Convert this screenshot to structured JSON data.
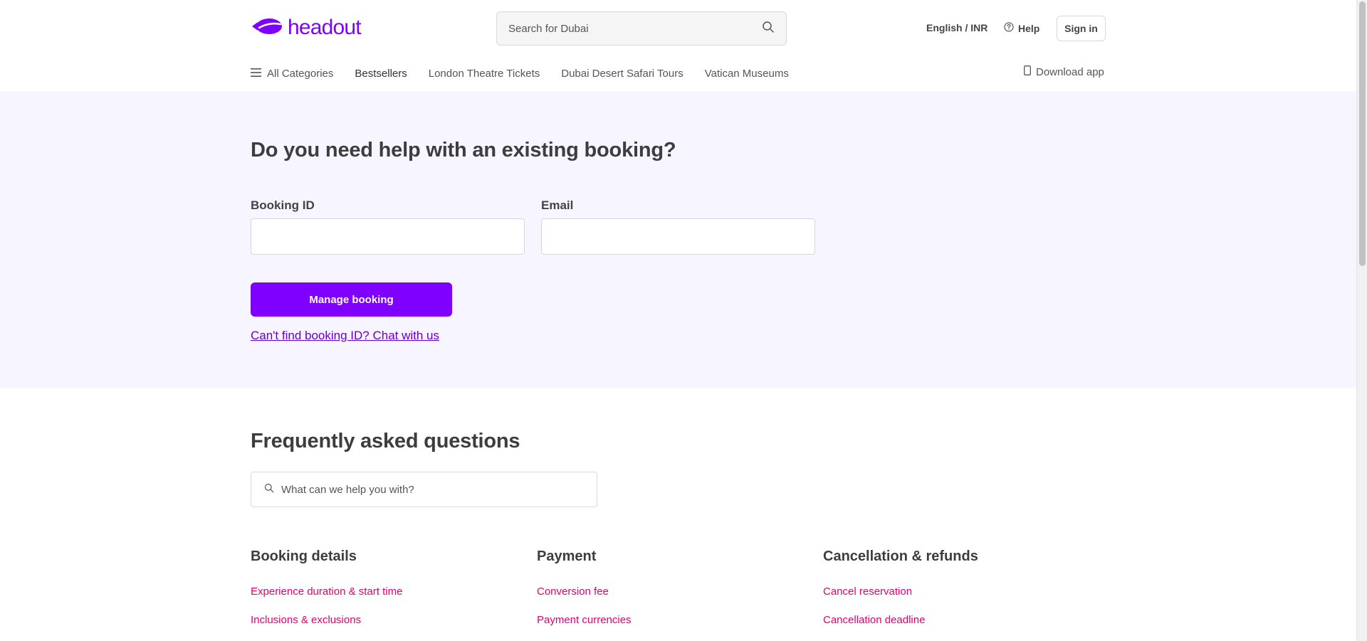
{
  "header": {
    "logo_text": "headout",
    "search_placeholder": "Search for Dubai",
    "language_currency": "English / INR",
    "help_label": "Help",
    "signin_label": "Sign in"
  },
  "nav": {
    "all_categories": "All Categories",
    "items": [
      "Bestsellers",
      "London Theatre Tickets",
      "Dubai Desert Safari Tours",
      "Vatican Museums"
    ],
    "download_app": "Download app"
  },
  "help_section": {
    "title": "Do you need help with an existing booking?",
    "booking_id_label": "Booking ID",
    "booking_id_value": "",
    "email_label": "Email",
    "email_value": "",
    "manage_button": "Manage booking",
    "chat_link": "Can't find booking ID? Chat with us"
  },
  "faq": {
    "title": "Frequently asked questions",
    "search_placeholder": "What can we help you with?",
    "columns": [
      {
        "title": "Booking details",
        "links": [
          "Experience duration & start time",
          "Inclusions & exclusions"
        ]
      },
      {
        "title": "Payment",
        "links": [
          "Conversion fee",
          "Payment currencies"
        ]
      },
      {
        "title": "Cancellation & refunds",
        "links": [
          "Cancel reservation",
          "Cancellation deadline"
        ]
      }
    ]
  },
  "colors": {
    "brand": "#8000ff",
    "faq_link": "#e5006e",
    "help_background": "#f7f5ff",
    "chat_link": "#6600cc"
  },
  "icons": {
    "logo": "headout-blimp-logo",
    "search": "search-icon",
    "help": "help-circle-icon",
    "menu": "menu-icon",
    "phone": "phone-icon"
  }
}
